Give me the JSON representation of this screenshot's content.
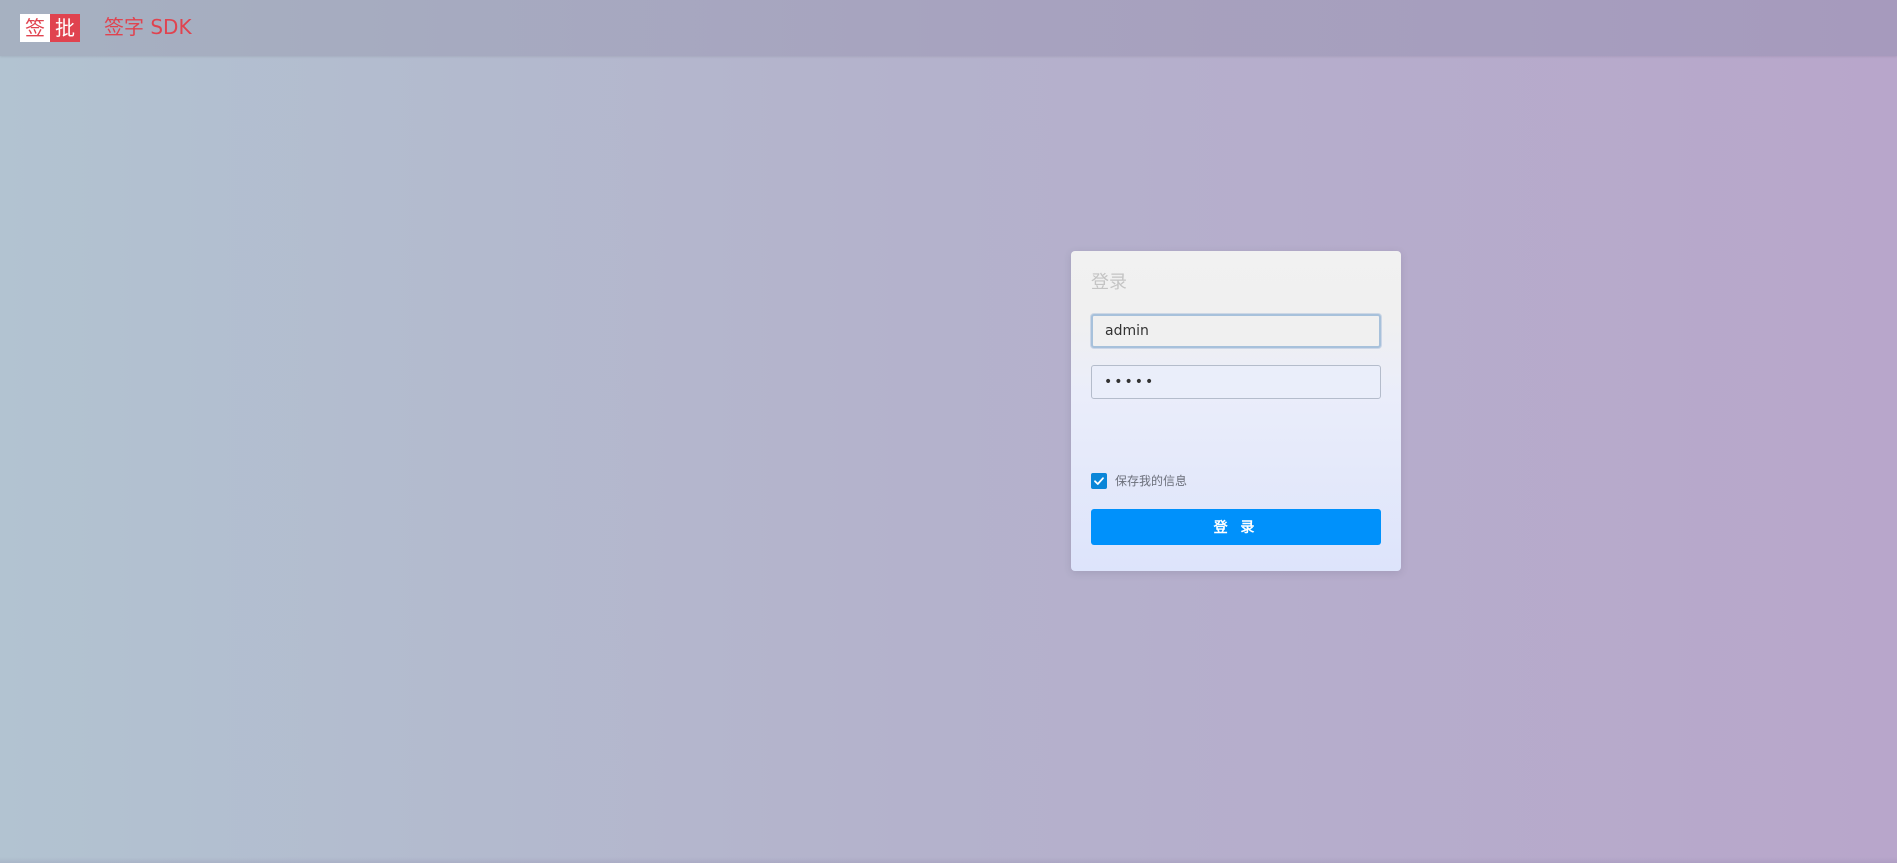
{
  "brand": {
    "logo_left": "签",
    "logo_right": "批",
    "title": "签字 SDK",
    "accent_color": "#e0434f"
  },
  "login": {
    "title": "登录",
    "username_value": "admin",
    "password_value": "•••••",
    "remember_label": "保存我的信息",
    "remember_checked": true,
    "submit_label": "登 录",
    "button_color": "#0091fb"
  }
}
